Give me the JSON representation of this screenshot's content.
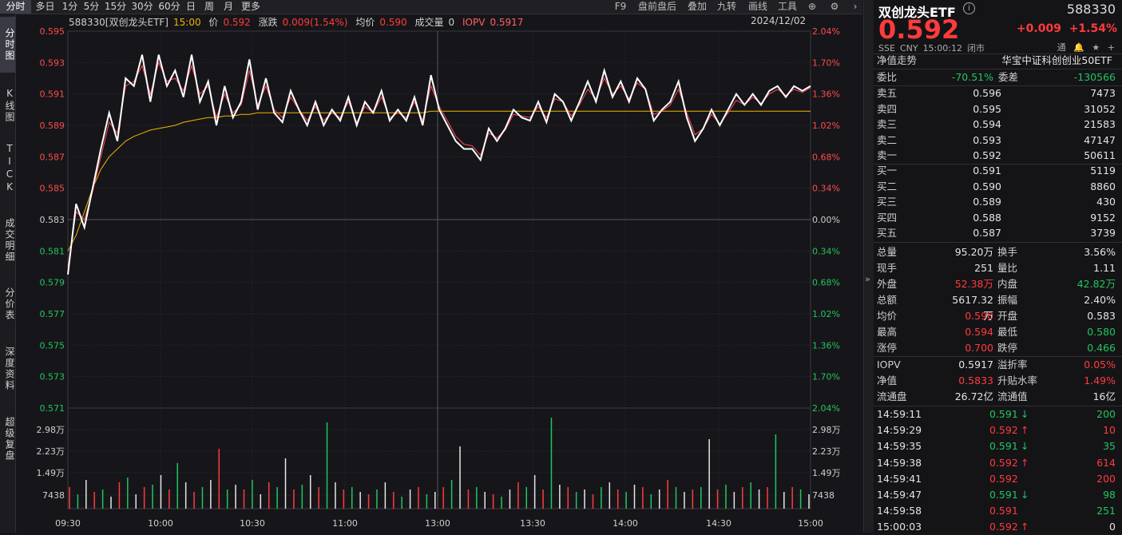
{
  "tabs": [
    "分时",
    "多日",
    "1分",
    "5分",
    "15分",
    "30分",
    "60分",
    "日",
    "周",
    "月",
    "更多"
  ],
  "top_right": [
    "F9",
    "盘前盘后",
    "叠加",
    "九转",
    "画线",
    "工具"
  ],
  "left_nav": [
    "分时图",
    "K线图",
    "TICK",
    "成交明细",
    "分价表",
    "深度资料",
    "超级复盘"
  ],
  "info": {
    "code_name": "588330[双创龙头ETF]",
    "time": "15:00",
    "price_label": "价",
    "price": "0.592",
    "change_label": "涨跌",
    "change": "0.009(1.54%)",
    "avg_label": "均价",
    "avg": "0.590",
    "vol_label": "成交量",
    "vol": "0",
    "iopv_label": "IOPV",
    "iopv": "0.5917",
    "date": "2024/12/02"
  },
  "axes": {
    "price_ticks": [
      "0.595",
      "0.593",
      "0.591",
      "0.589",
      "0.587",
      "0.585",
      "0.583",
      "0.581",
      "0.579",
      "0.577",
      "0.575",
      "0.573",
      "0.571"
    ],
    "pct_ticks": [
      "2.04%",
      "1.70%",
      "1.36%",
      "1.02%",
      "0.68%",
      "0.34%",
      "0.00%",
      "0.34%",
      "0.68%",
      "1.02%",
      "1.36%",
      "1.70%",
      "2.04%"
    ],
    "vol_ticks": [
      "2.98万",
      "2.23万",
      "1.49万",
      "7438"
    ],
    "vol_ticks_right": [
      "2.98万",
      "2.23万",
      "1.49万",
      "7438"
    ],
    "time_ticks": [
      "09:30",
      "10:00",
      "10:30",
      "11:00",
      "13:00",
      "13:30",
      "14:00",
      "14:30",
      "15:00"
    ]
  },
  "chart_data": {
    "type": "line",
    "series": [
      {
        "name": "价",
        "color": "#ffffff",
        "values": [
          0.5795,
          0.584,
          0.5825,
          0.585,
          0.5875,
          0.5898,
          0.588,
          0.592,
          0.5915,
          0.5935,
          0.5905,
          0.5935,
          0.5915,
          0.5925,
          0.5908,
          0.5935,
          0.5905,
          0.5918,
          0.589,
          0.5915,
          0.5895,
          0.5905,
          0.5932,
          0.59,
          0.592,
          0.5898,
          0.5892,
          0.5912,
          0.59,
          0.589,
          0.5905,
          0.589,
          0.59,
          0.5893,
          0.5908,
          0.589,
          0.5905,
          0.5898,
          0.5912,
          0.5893,
          0.59,
          0.5893,
          0.5908,
          0.589,
          0.5922,
          0.59,
          0.589,
          0.588,
          0.5875,
          0.5875,
          0.5868,
          0.5888,
          0.588,
          0.5888,
          0.59,
          0.5895,
          0.5893,
          0.5905,
          0.5892,
          0.591,
          0.5905,
          0.5893,
          0.5905,
          0.5918,
          0.5905,
          0.5925,
          0.5908,
          0.5918,
          0.5905,
          0.592,
          0.5913,
          0.5893,
          0.59,
          0.5905,
          0.5918,
          0.5895,
          0.588,
          0.5888,
          0.59,
          0.589,
          0.59,
          0.591,
          0.5903,
          0.591,
          0.5903,
          0.5912,
          0.5915,
          0.5908,
          0.5915,
          0.5912,
          0.5915
        ]
      },
      {
        "name": "IOPV",
        "color": "#ff4b5a",
        "values": [
          0.58,
          0.5835,
          0.583,
          0.5848,
          0.587,
          0.5892,
          0.5885,
          0.5915,
          0.5918,
          0.5928,
          0.591,
          0.593,
          0.5918,
          0.592,
          0.5912,
          0.5928,
          0.591,
          0.5915,
          0.5895,
          0.591,
          0.5898,
          0.5903,
          0.5925,
          0.5903,
          0.5915,
          0.59,
          0.5895,
          0.5908,
          0.59,
          0.5893,
          0.5902,
          0.5893,
          0.5898,
          0.5895,
          0.5905,
          0.5892,
          0.5902,
          0.5898,
          0.5908,
          0.5895,
          0.5898,
          0.5895,
          0.5905,
          0.5893,
          0.5915,
          0.5902,
          0.5893,
          0.5883,
          0.5878,
          0.5877,
          0.5871,
          0.5885,
          0.5882,
          0.5887,
          0.5897,
          0.5896,
          0.5895,
          0.5902,
          0.5895,
          0.5907,
          0.5905,
          0.5896,
          0.5903,
          0.5913,
          0.5907,
          0.592,
          0.591,
          0.5915,
          0.5907,
          0.5917,
          0.5913,
          0.5897,
          0.5899,
          0.5903,
          0.5913,
          0.5898,
          0.5884,
          0.5888,
          0.5897,
          0.5891,
          0.5898,
          0.5906,
          0.5903,
          0.5908,
          0.5904,
          0.591,
          0.5913,
          0.5909,
          0.5913,
          0.5911,
          0.5914
        ]
      },
      {
        "name": "均价",
        "color": "#f0b400",
        "values": [
          0.581,
          0.582,
          0.5835,
          0.585,
          0.5862,
          0.587,
          0.5875,
          0.588,
          0.5883,
          0.5885,
          0.5887,
          0.5888,
          0.5889,
          0.589,
          0.5892,
          0.5893,
          0.5894,
          0.5895,
          0.5895,
          0.5896,
          0.5896,
          0.5897,
          0.5897,
          0.5898,
          0.5898,
          0.5898,
          0.5898,
          0.5898,
          0.5898,
          0.5898,
          0.5898,
          0.5898,
          0.5898,
          0.5898,
          0.5898,
          0.5898,
          0.5898,
          0.5898,
          0.5898,
          0.5898,
          0.5898,
          0.5898,
          0.5898,
          0.5898,
          0.5899,
          0.5899,
          0.5899,
          0.5899,
          0.5899,
          0.5899,
          0.5899,
          0.5899,
          0.5899,
          0.5899,
          0.5899,
          0.5899,
          0.5899,
          0.5899,
          0.5899,
          0.5899,
          0.5899,
          0.5899,
          0.5899,
          0.5899,
          0.5899,
          0.5899,
          0.5899,
          0.5899,
          0.5899,
          0.5899,
          0.5899,
          0.5899,
          0.5899,
          0.5899,
          0.5899,
          0.5899,
          0.5899,
          0.5899,
          0.5899,
          0.5899,
          0.5899,
          0.5899,
          0.5899,
          0.5899,
          0.5899,
          0.5899,
          0.5899,
          0.5899,
          0.5899,
          0.5899,
          0.5899
        ]
      }
    ],
    "volume": [
      9000,
      6000,
      12000,
      7000,
      8000,
      5000,
      11000,
      13000,
      6000,
      9000,
      10000,
      14000,
      8000,
      19000,
      11000,
      7000,
      9000,
      12000,
      25000,
      8000,
      10000,
      8000,
      12000,
      6000,
      11000,
      9000,
      21000,
      8000,
      10000,
      14000,
      9000,
      36000,
      11000,
      8000,
      9000,
      7000,
      6000,
      8000,
      11000,
      7000,
      5000,
      8000,
      9000,
      6000,
      7000,
      9000,
      12000,
      26000,
      8000,
      9000,
      7000,
      6000,
      5000,
      8000,
      11000,
      9000,
      14000,
      8000,
      38000,
      10000,
      9000,
      7000,
      8000,
      6000,
      9000,
      11000,
      8000,
      7000,
      10000,
      9000,
      6000,
      8000,
      12000,
      9000,
      7000,
      8000,
      9000,
      29000,
      8000,
      10000,
      7000,
      9000,
      11000,
      8000,
      9000,
      31000,
      7000,
      9000,
      8000,
      6000
    ],
    "ylim": [
      0.571,
      0.595
    ]
  },
  "right": {
    "title": "双创龙头ETF",
    "code": "588330",
    "price": "0.592",
    "change": "+0.009",
    "change_pct": "+1.54%",
    "sub": [
      "SSE",
      "CNY",
      "15:00:12",
      "闭市"
    ],
    "sub_icons": "通 🔔 ★ +",
    "nav_label": "净值走势",
    "index_name": "华宝中证科创创业50ETF",
    "ratio": {
      "label1": "委比",
      "v1": "-70.51%",
      "label2": "委差",
      "v2": "-130566"
    },
    "asks": [
      {
        "l": "卖五",
        "p": "0.596",
        "v": "7473"
      },
      {
        "l": "卖四",
        "p": "0.595",
        "v": "31052"
      },
      {
        "l": "卖三",
        "p": "0.594",
        "v": "21583"
      },
      {
        "l": "卖二",
        "p": "0.593",
        "v": "47147"
      },
      {
        "l": "卖一",
        "p": "0.592",
        "v": "50611"
      }
    ],
    "bids": [
      {
        "l": "买一",
        "p": "0.591",
        "v": "5119"
      },
      {
        "l": "买二",
        "p": "0.590",
        "v": "8860"
      },
      {
        "l": "买三",
        "p": "0.589",
        "v": "430"
      },
      {
        "l": "买四",
        "p": "0.588",
        "v": "9152"
      },
      {
        "l": "买五",
        "p": "0.587",
        "v": "3739"
      }
    ],
    "stats": [
      {
        "l1": "总量",
        "v1": "95.20万",
        "c1": "w",
        "l2": "换手",
        "v2": "3.56%",
        "c2": "w"
      },
      {
        "l1": "现手",
        "v1": "251",
        "c1": "w",
        "l2": "量比",
        "v2": "1.11",
        "c2": "w"
      },
      {
        "l1": "外盘",
        "v1": "52.38万",
        "c1": "r",
        "l2": "内盘",
        "v2": "42.82万",
        "c2": "g"
      },
      {
        "l1": "总额",
        "v1": "5617.32万",
        "c1": "w",
        "l2": "振幅",
        "v2": "2.40%",
        "c2": "w"
      },
      {
        "l1": "均价",
        "v1": "0.590",
        "c1": "r",
        "l2": "开盘",
        "v2": "0.583",
        "c2": "w"
      },
      {
        "l1": "最高",
        "v1": "0.594",
        "c1": "r",
        "l2": "最低",
        "v2": "0.580",
        "c2": "g"
      },
      {
        "l1": "涨停",
        "v1": "0.700",
        "c1": "r",
        "l2": "跌停",
        "v2": "0.466",
        "c2": "g"
      }
    ],
    "fund": [
      {
        "l1": "IOPV",
        "v1": "0.5917",
        "c1": "w",
        "l2": "溢折率",
        "v2": "0.05%",
        "c2": "r"
      },
      {
        "l1": "净值",
        "v1": "0.5833",
        "c1": "r",
        "l2": "升贴水率",
        "v2": "1.49%",
        "c2": "r"
      },
      {
        "l1": "流通盘",
        "v1": "26.72亿",
        "c1": "w",
        "l2": "流通值",
        "v2": "16亿",
        "c2": "w"
      }
    ],
    "ticks": [
      {
        "t": "14:59:11",
        "p": "0.591",
        "a": "↓",
        "c": "g",
        "v": "200",
        "vc": "g"
      },
      {
        "t": "14:59:29",
        "p": "0.592",
        "a": "↑",
        "c": "r",
        "v": "10",
        "vc": "r"
      },
      {
        "t": "14:59:35",
        "p": "0.591",
        "a": "↓",
        "c": "g",
        "v": "35",
        "vc": "g"
      },
      {
        "t": "14:59:38",
        "p": "0.592",
        "a": "↑",
        "c": "r",
        "v": "614",
        "vc": "r"
      },
      {
        "t": "14:59:41",
        "p": "0.592",
        "a": "",
        "c": "r",
        "v": "200",
        "vc": "r"
      },
      {
        "t": "14:59:47",
        "p": "0.591",
        "a": "↓",
        "c": "g",
        "v": "98",
        "vc": "g"
      },
      {
        "t": "14:59:58",
        "p": "0.591",
        "a": "",
        "c": "r",
        "v": "251",
        "vc": "g"
      },
      {
        "t": "15:00:03",
        "p": "0.592",
        "a": "↑",
        "c": "r",
        "v": "0",
        "vc": "w"
      }
    ]
  }
}
